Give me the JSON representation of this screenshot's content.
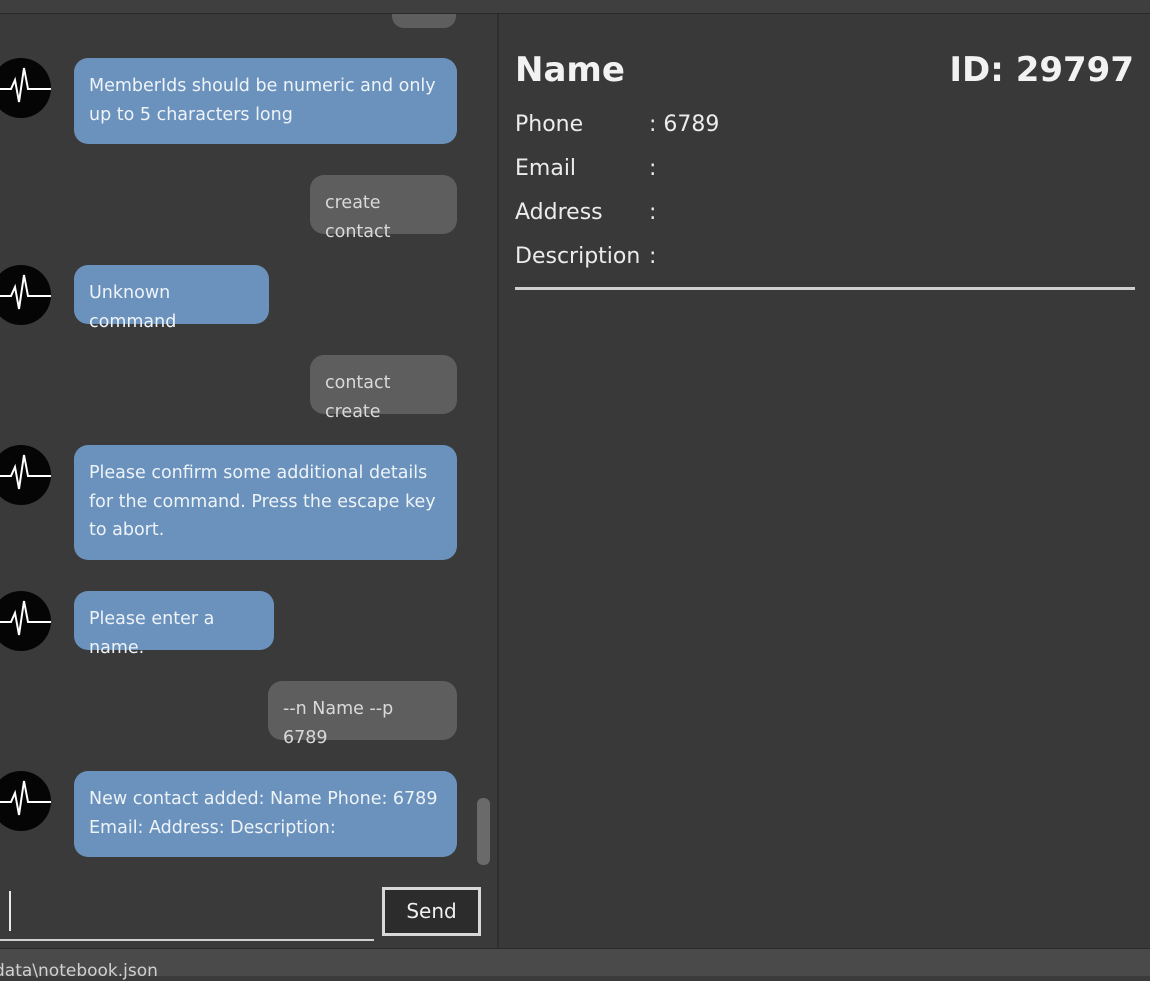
{
  "status_path": "data\\notebook.json",
  "chat": {
    "messages": [
      {
        "sender": "bot",
        "text": "MemberIds should be numeric and only up to 5 characters long"
      },
      {
        "sender": "user",
        "text": "create contact"
      },
      {
        "sender": "bot",
        "text": "Unknown command"
      },
      {
        "sender": "user",
        "text": "contact create"
      },
      {
        "sender": "bot",
        "text": "Please confirm some additional details for the command. Press the escape key to abort."
      },
      {
        "sender": "bot",
        "text": "Please enter a name."
      },
      {
        "sender": "user",
        "text": "--n Name --p 6789"
      },
      {
        "sender": "bot",
        "text": "New contact added: Name Phone: 6789 Email:  Address:  Description:"
      }
    ],
    "input_value": "",
    "send_label": "Send"
  },
  "contact": {
    "name": "Name",
    "id_text": "ID: 29797",
    "fields": [
      {
        "label": "Phone",
        "value": ": 6789"
      },
      {
        "label": "Email",
        "value": ":"
      },
      {
        "label": "Address",
        "value": ":"
      },
      {
        "label": "Description",
        "value": ":"
      }
    ]
  },
  "icons": {
    "avatar": "heartbeat-icon"
  }
}
